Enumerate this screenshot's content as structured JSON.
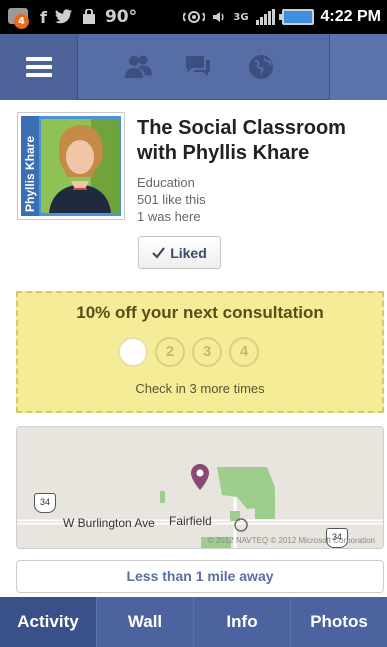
{
  "status_bar": {
    "notification_count": "4",
    "temperature": "90°",
    "network": "3G",
    "time": "4:22 PM"
  },
  "header": {
    "icons": [
      "menu-icon",
      "friends-icon",
      "messages-icon",
      "globe-icon"
    ]
  },
  "page": {
    "title": "The Social Classroom with Phyllis Khare",
    "picture_text": "Phyllis Khare",
    "category": "Education",
    "likes": "501 like this",
    "checkins": "1 was here",
    "liked_label": "Liked"
  },
  "offer": {
    "title": "10% off your next consultation",
    "checkins": [
      "",
      "2",
      "3",
      "4"
    ],
    "progress": "1 of 4",
    "subtitle": "Check in 3 more times"
  },
  "map": {
    "road_label": "W Burlington Ave",
    "town_label": "Fairfield",
    "route_left": "34",
    "route_right": "34",
    "copyright": "© 2012 NAVTEQ © 2012 Microsoft Corporation"
  },
  "distance": {
    "label": "Less than 1 mile away"
  },
  "tabs": [
    {
      "label": "Activity",
      "active": true
    },
    {
      "label": "Wall",
      "active": false
    },
    {
      "label": "Info",
      "active": false
    },
    {
      "label": "Photos",
      "active": false
    }
  ],
  "colors": {
    "header_blue": "#566da5",
    "tab_blue": "#4c639f",
    "offer_yellow": "#f5ec98",
    "link_blue": "#5a6fa3"
  }
}
